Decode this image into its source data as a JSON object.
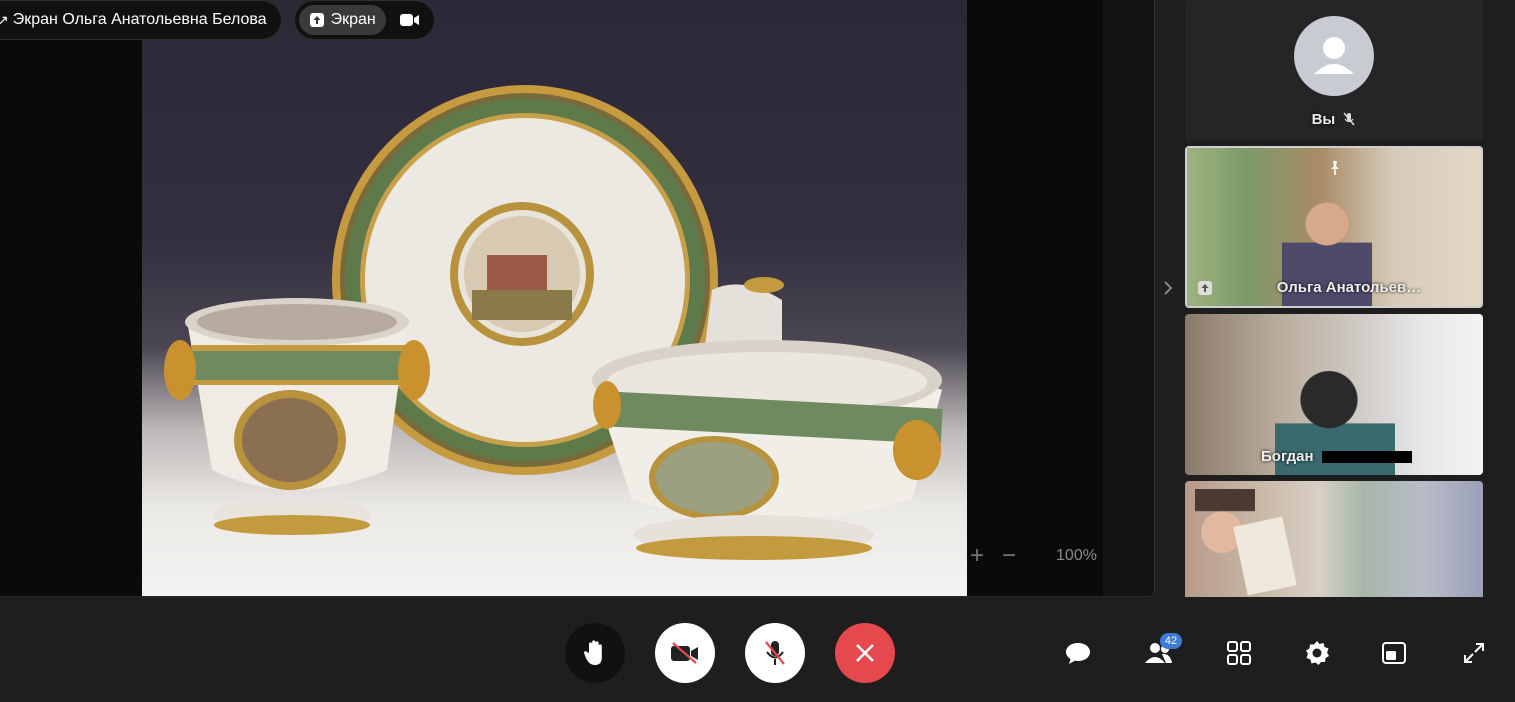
{
  "share": {
    "title": "Экран Ольга Анатольевна Белова",
    "tab_label": "Экран",
    "zoom_plus": "+",
    "zoom_minus": "−",
    "zoom_value": "100%"
  },
  "participants": [
    {
      "name": "Вы",
      "muted": true,
      "avatar": true
    },
    {
      "name": "Ольга Анатольев…",
      "pinned": true,
      "sharing": true
    },
    {
      "name": "Богдан"
    },
    {
      "name": ""
    }
  ],
  "controls": {
    "raise_hand": "raise-hand",
    "camera": "camera-off",
    "mic": "mic-off",
    "end_call": "end-call"
  },
  "toolbar": {
    "participants_count": "42"
  },
  "colors": {
    "end_call": "#e5484d",
    "badge": "#3d7bd6",
    "background": "#1e1e1f"
  }
}
